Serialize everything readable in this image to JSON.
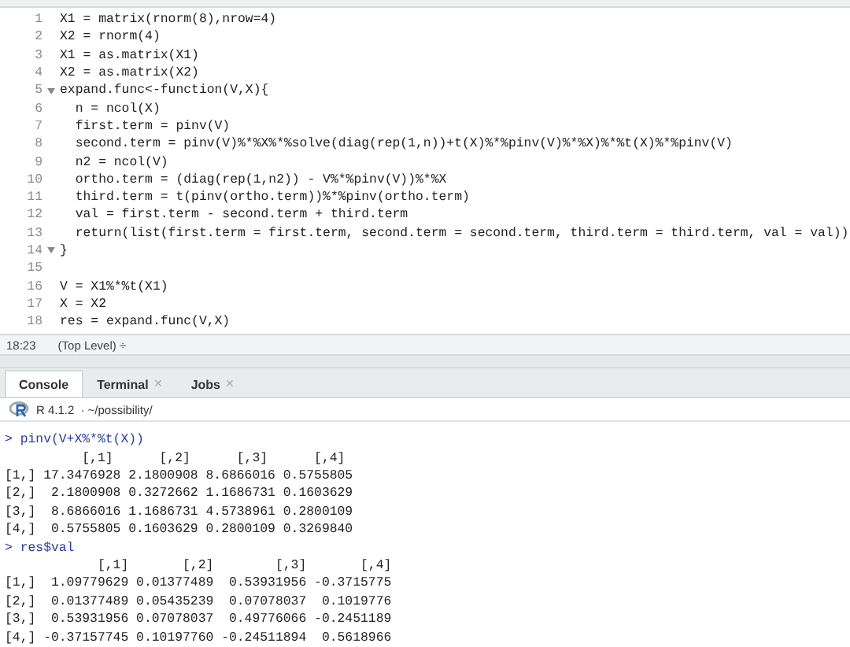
{
  "editor": {
    "lines": [
      {
        "number": "1",
        "code": "X1 = matrix(rnorm(8),nrow=4)",
        "foldable": false
      },
      {
        "number": "2",
        "code": "X2 = rnorm(4)",
        "foldable": false
      },
      {
        "number": "3",
        "code": "X1 = as.matrix(X1)",
        "foldable": false
      },
      {
        "number": "4",
        "code": "X2 = as.matrix(X2)",
        "foldable": false
      },
      {
        "number": "5",
        "code": "expand.func<-function(V,X){",
        "foldable": true
      },
      {
        "number": "6",
        "code": "  n = ncol(X)",
        "foldable": false
      },
      {
        "number": "7",
        "code": "  first.term = pinv(V)",
        "foldable": false
      },
      {
        "number": "8",
        "code": "  second.term = pinv(V)%*%X%*%solve(diag(rep(1,n))+t(X)%*%pinv(V)%*%X)%*%t(X)%*%pinv(V)",
        "foldable": false
      },
      {
        "number": "9",
        "code": "  n2 = ncol(V)",
        "foldable": false
      },
      {
        "number": "10",
        "code": "  ortho.term = (diag(rep(1,n2)) - V%*%pinv(V))%*%X",
        "foldable": false
      },
      {
        "number": "11",
        "code": "  third.term = t(pinv(ortho.term))%*%pinv(ortho.term)",
        "foldable": false
      },
      {
        "number": "12",
        "code": "  val = first.term - second.term + third.term",
        "foldable": false
      },
      {
        "number": "13",
        "code": "  return(list(first.term = first.term, second.term = second.term, third.term = third.term, val = val))",
        "foldable": false
      },
      {
        "number": "14",
        "code": "}",
        "foldable": true
      },
      {
        "number": "15",
        "foldable": false
      },
      {
        "number": "16",
        "code": "V = X1%*%t(X1)",
        "foldable": false
      },
      {
        "number": "17",
        "code": "X = X2",
        "foldable": false
      },
      {
        "number": "18",
        "code": "res = expand.func(V,X)",
        "foldable": false
      }
    ]
  },
  "status_bar": {
    "position": "18:23",
    "scope": "(Top Level) ÷"
  },
  "tabs": [
    {
      "label": "Console",
      "selected": true,
      "closable": false
    },
    {
      "label": "Terminal",
      "selected": false,
      "closable": true,
      "close": "✕"
    },
    {
      "label": "Jobs",
      "selected": false,
      "closable": true,
      "close": "✕"
    }
  ],
  "console_header": {
    "version": "R 4.1.2",
    "path": "· ~/possibility/"
  },
  "console": [
    {
      "kind": "input",
      "text": "> pinv(V+X%*%t(X))"
    },
    {
      "kind": "output",
      "text": "          [,1]      [,2]      [,3]      [,4]"
    },
    {
      "kind": "output",
      "text": "[1,] 17.3476928 2.1800908 8.6866016 0.5755805"
    },
    {
      "kind": "output",
      "text": "[2,]  2.1800908 0.3272662 1.1686731 0.1603629"
    },
    {
      "kind": "output",
      "text": "[3,]  8.6866016 1.1686731 4.5738961 0.2800109"
    },
    {
      "kind": "output",
      "text": "[4,]  0.5755805 0.1603629 0.2800109 0.3269840"
    },
    {
      "kind": "input",
      "text": "> res$val"
    },
    {
      "kind": "output",
      "text": "            [,1]       [,2]        [,3]       [,4]"
    },
    {
      "kind": "output",
      "text": "[1,]  1.09779629 0.01377489  0.53931956 -0.3715775"
    },
    {
      "kind": "output",
      "text": "[2,]  0.01377489 0.05435239  0.07078037  0.1019776"
    },
    {
      "kind": "output",
      "text": "[3,]  0.53931956 0.07078037  0.49776066 -0.2451189"
    },
    {
      "kind": "output",
      "text": "[4,] -0.37157745 0.10197760 -0.24511894  0.5618966"
    }
  ]
}
